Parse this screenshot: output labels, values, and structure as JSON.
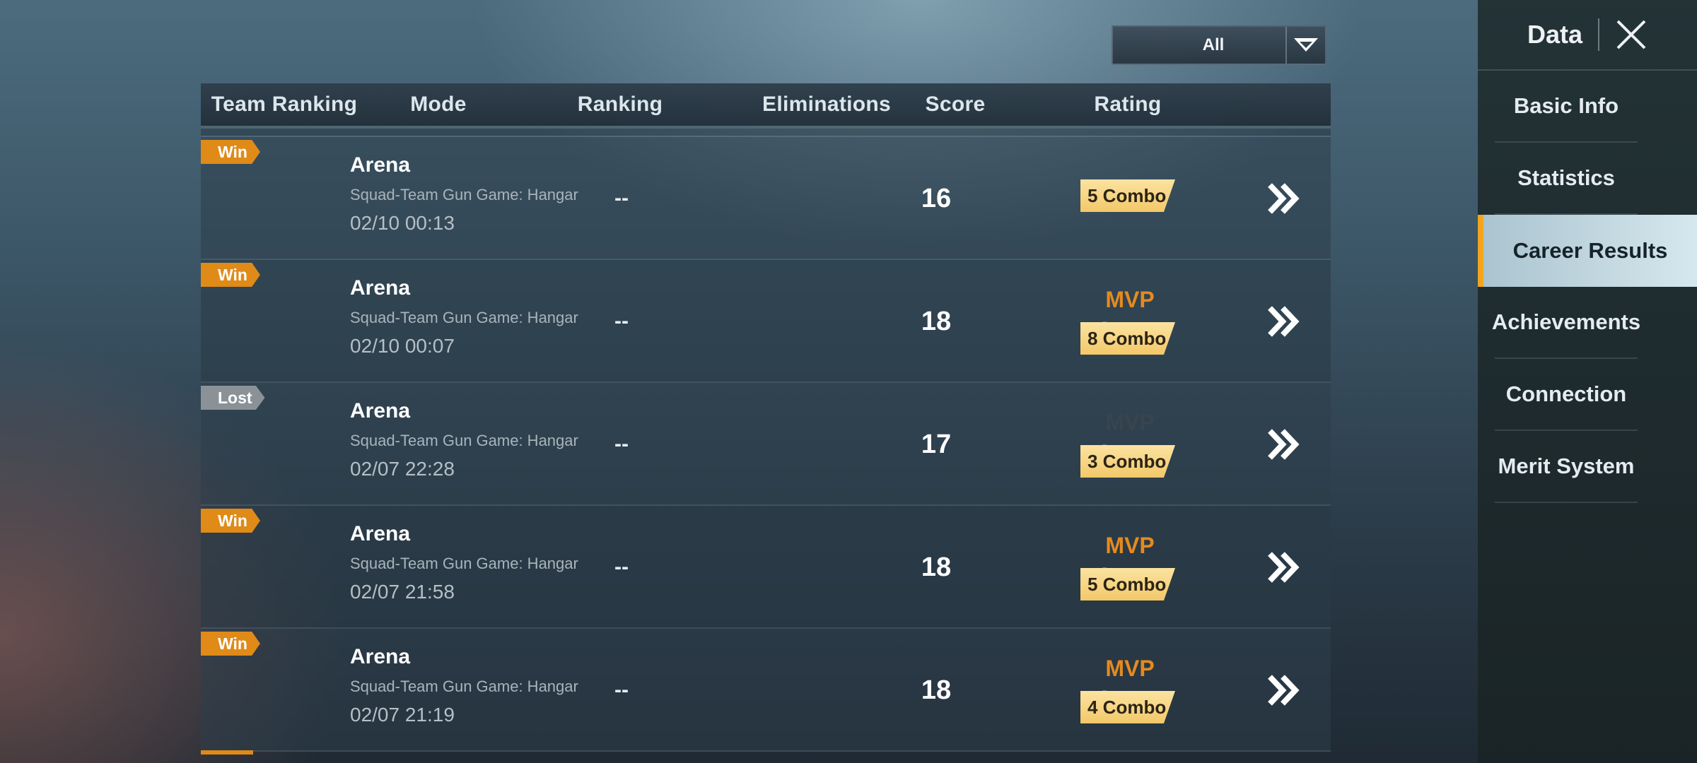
{
  "filter": {
    "label": "All",
    "icon": "dropdown-arrow-icon"
  },
  "table": {
    "headers": [
      "Team Ranking",
      "Mode",
      "Ranking",
      "Eliminations",
      "Score",
      "Rating"
    ],
    "rows": [
      {
        "result": "Win",
        "mode": "Arena",
        "sub": "Squad-Team Gun Game: Hangar",
        "time": "02/10 00:13",
        "ranking": "--",
        "eliminations": "16",
        "score": "-",
        "mvp": "",
        "combo": "5 Combo"
      },
      {
        "result": "Win",
        "mode": "Arena",
        "sub": "Squad-Team Gun Game: Hangar",
        "time": "02/10 00:07",
        "ranking": "--",
        "eliminations": "18",
        "score": "-",
        "mvp": "MVP",
        "combo": "8 Combo"
      },
      {
        "result": "Lost",
        "mode": "Arena",
        "sub": "Squad-Team Gun Game: Hangar",
        "time": "02/07 22:28",
        "ranking": "--",
        "eliminations": "17",
        "score": "-",
        "mvp": "MVP",
        "combo": "3 Combo"
      },
      {
        "result": "Win",
        "mode": "Arena",
        "sub": "Squad-Team Gun Game: Hangar",
        "time": "02/07 21:58",
        "ranking": "--",
        "eliminations": "18",
        "score": "-",
        "mvp": "MVP",
        "combo": "5 Combo"
      },
      {
        "result": "Win",
        "mode": "Arena",
        "sub": "Squad-Team Gun Game: Hangar",
        "time": "02/07 21:19",
        "ranking": "--",
        "eliminations": "18",
        "score": "-",
        "mvp": "MVP",
        "combo": "4 Combo"
      }
    ]
  },
  "panel": {
    "title": "Data",
    "close_icon": "close-icon",
    "items": [
      "Basic Info",
      "Statistics",
      "Career Results",
      "Achievements",
      "Connection",
      "Merit System"
    ],
    "active": "Career Results"
  },
  "colors": {
    "win": "#e08a18",
    "lost": "#8b9297",
    "mvp": "#e58a1f",
    "accent": "#f2a51c"
  }
}
